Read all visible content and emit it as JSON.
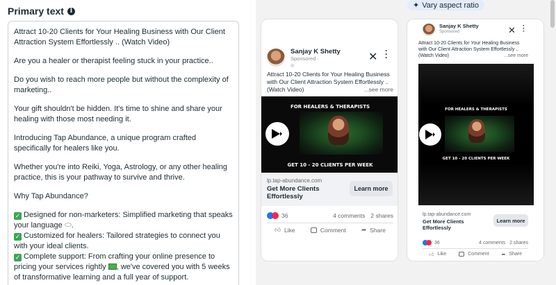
{
  "primary_text": {
    "title": "Primary text",
    "info_icon": "i",
    "paragraphs": [
      "Attract 10-20 Clients for Your Healing Business with Our Client Attraction System Effortlessly .. (Watch Video)",
      "Are you a healer or therapist feeling stuck in your practice..",
      "Do you wish to reach more people but without the complexity of marketing..",
      "Your gift shouldn't be hidden. It's time to shine and share your healing with those most needing it.",
      "Introducing Tap Abundance, a unique program crafted specifically for healers like you.",
      "Whether you're into Reiki, Yoga, Astrology, or any other healing practice, this is your pathway to survive and thrive.",
      "Why Tap Abundance?"
    ],
    "bullets": [
      "Designed for non-marketers: Simplified marketing that speaks your language",
      "Customized for healers: Tailored strategies to connect you with your ideal clients.",
      "Complete support: From crafting your online presence to pricing your services rightly",
      ", we've covered you with 5 weeks of transformative learning and a full year of support."
    ]
  },
  "vary_chip": {
    "label": "Vary aspect ratio",
    "icon": "sparkle-icon"
  },
  "feed_ad": {
    "page_name": "Sanjay K Shetty",
    "sponsored": "Sponsored ·",
    "text": "Attract 10-20 Clients for Your Healing Business with Our Client Attraction System Effortlessly .. (Watch Video)",
    "see_more": "...see more",
    "video_top": "FOR HEALERS & THERAPISTS",
    "video_bottom": "GET 10 - 20 CLIENTS PER WEEK",
    "domain": "lp.tap-abundance.com",
    "headline": "Get More Clients Effortlessly",
    "cta": "Learn more",
    "reaction_count": "36",
    "comments": "4 comments",
    "shares": "2 shares",
    "like": "Like",
    "comment": "Comment",
    "share": "Share"
  },
  "story_ad": {
    "page_name": "Sanjay K Shetty",
    "sponsored": "Sponsored ·",
    "text": "Attract 10-20 Clients for Your Healing Business with Our Client Attraction System Effortlessly .. (Watch Video)",
    "see_more": "...see more",
    "video_top": "FOR HEALERS & THERAPISTS",
    "video_bottom": "GET 10 - 20 CLIENTS PER WEEK",
    "domain": "lp.tap-abundance.com",
    "headline": "Get More Clients Effortlessly",
    "cta": "Learn more",
    "reaction_count": "36",
    "comments": "4 comments",
    "shares": "2 shares",
    "like": "Like",
    "comment": "Comment",
    "share": "Share"
  },
  "colors": {
    "accent": "#1877f2",
    "chip_bg": "#e3ecfa",
    "panel_bg": "#f2f2f2"
  }
}
